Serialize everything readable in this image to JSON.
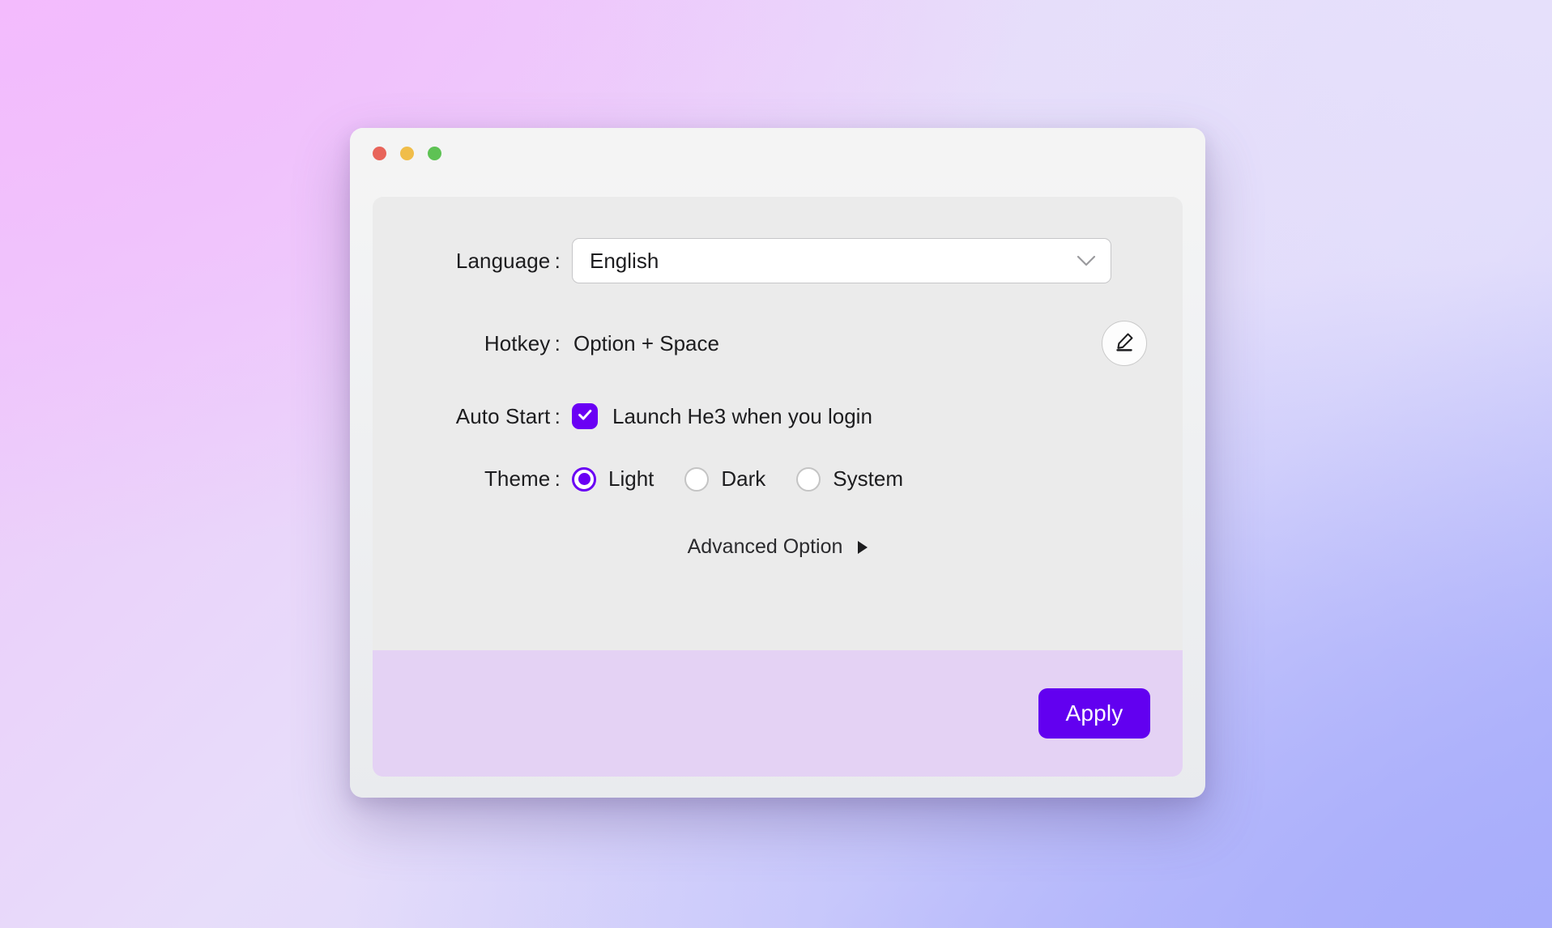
{
  "window": {
    "traffic_lights": [
      {
        "name": "close",
        "color": "#E8645A"
      },
      {
        "name": "minimize",
        "color": "#F0BD49"
      },
      {
        "name": "maximize",
        "color": "#5EC254"
      }
    ]
  },
  "settings": {
    "language": {
      "label": "Language :",
      "value": "English",
      "chevron_icon": "chevron-down-icon"
    },
    "hotkey": {
      "label": "Hotkey :",
      "value": "Option + Space",
      "edit_icon": "pencil-edit-icon"
    },
    "auto_start": {
      "label": "Auto Start :",
      "checkbox_label": "Launch He3 when you login",
      "checked": true,
      "check_icon": "checkmark-icon"
    },
    "theme": {
      "label": "Theme :",
      "options": [
        {
          "label": "Light",
          "selected": true
        },
        {
          "label": "Dark",
          "selected": false
        },
        {
          "label": "System",
          "selected": false
        }
      ]
    },
    "advanced": {
      "label": "Advanced Option",
      "arrow_icon": "triangle-right-icon"
    }
  },
  "footer": {
    "apply_label": "Apply"
  },
  "colors": {
    "accent_purple": "#6A00F4",
    "apply_purple": "#6200F0",
    "footer_lavender": "#E4D2F4",
    "panel_grey": "#EBEBEB",
    "titlebar_grey": "#F4F4F4",
    "text_primary": "#1D1D1F"
  }
}
